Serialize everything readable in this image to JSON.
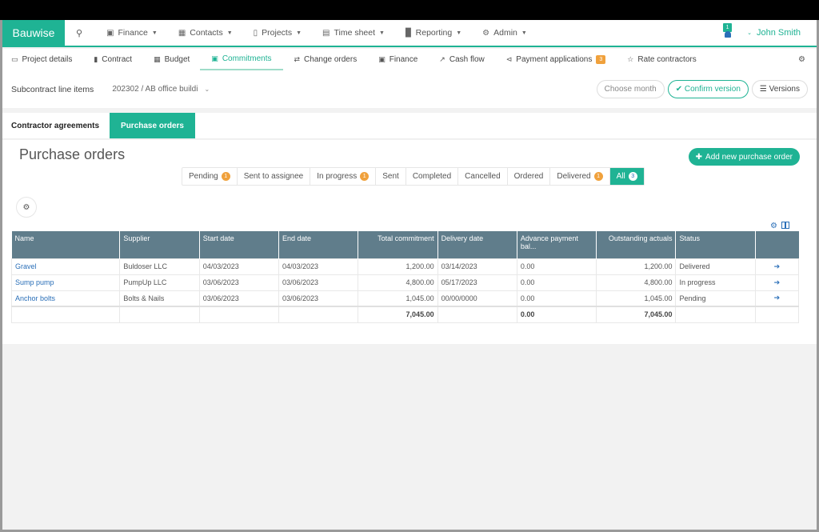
{
  "app": {
    "brand": "Bauwise"
  },
  "topnav": {
    "items": [
      {
        "label": "Finance",
        "icon": "book-icon"
      },
      {
        "label": "Contacts",
        "icon": "contact-card-icon"
      },
      {
        "label": "Projects",
        "icon": "folder-icon"
      },
      {
        "label": "Time sheet",
        "icon": "calendar-icon"
      },
      {
        "label": "Reporting",
        "icon": "bar-chart-icon"
      },
      {
        "label": "Admin",
        "icon": "gear-icon"
      }
    ],
    "notifications_count": "1",
    "user": "John Smith"
  },
  "subnav": {
    "items": [
      {
        "label": "Project details",
        "icon": "monitor-icon"
      },
      {
        "label": "Contract",
        "icon": "bookmark-icon"
      },
      {
        "label": "Budget",
        "icon": "calculator-icon"
      },
      {
        "label": "Commitments",
        "icon": "wallet-icon"
      },
      {
        "label": "Change orders",
        "icon": "exchange-icon"
      },
      {
        "label": "Finance",
        "icon": "book-icon"
      },
      {
        "label": "Cash flow",
        "icon": "line-chart-icon"
      },
      {
        "label": "Payment applications",
        "icon": "share-icon",
        "badge": "3"
      },
      {
        "label": "Rate contractors",
        "icon": "star-icon"
      }
    ],
    "active": "Commitments"
  },
  "projbar": {
    "label": "Subcontract line items",
    "project": "202302 / AB office buildi",
    "choose_month": "Choose month",
    "confirm_version": "Confirm version",
    "versions": "Versions"
  },
  "tabs": {
    "items": [
      "Contractor agreements",
      "Purchase orders"
    ],
    "active": "Purchase orders"
  },
  "main": {
    "title": "Purchase orders",
    "add_button": "Add new purchase order",
    "filters": [
      {
        "label": "Pending",
        "count": "1"
      },
      {
        "label": "Sent to assignee"
      },
      {
        "label": "In progress",
        "count": "1"
      },
      {
        "label": "Sent"
      },
      {
        "label": "Completed"
      },
      {
        "label": "Cancelled"
      },
      {
        "label": "Ordered"
      },
      {
        "label": "Delivered",
        "count": "1"
      },
      {
        "label": "All",
        "count": "3",
        "active": true
      }
    ]
  },
  "table": {
    "headers": [
      "Name",
      "Supplier",
      "Start date",
      "End date",
      "Total commitment",
      "Delivery date",
      "Advance payment bal...",
      "Outstanding actuals",
      "Status",
      ""
    ],
    "rows": [
      [
        "Gravel",
        "Buldoser LLC",
        "04/03/2023",
        "04/03/2023",
        "1,200.00",
        "03/14/2023",
        "0.00",
        "1,200.00",
        "Delivered"
      ],
      [
        "Sump pump",
        "PumpUp LLC",
        "03/06/2023",
        "03/06/2023",
        "4,800.00",
        "05/17/2023",
        "0.00",
        "4,800.00",
        "In progress"
      ],
      [
        "Anchor bolts",
        "Bolts & Nails",
        "03/06/2023",
        "03/06/2023",
        "1,045.00",
        "00/00/0000",
        "0.00",
        "1,045.00",
        "Pending"
      ]
    ],
    "totals": [
      "",
      "",
      "",
      "",
      "7,045.00",
      "",
      "0.00",
      "7,045.00",
      "",
      ""
    ]
  },
  "colors": {
    "accent": "#1fb394",
    "header": "#607d8b",
    "link": "#2a6fb8",
    "badge": "#f0a13c"
  }
}
